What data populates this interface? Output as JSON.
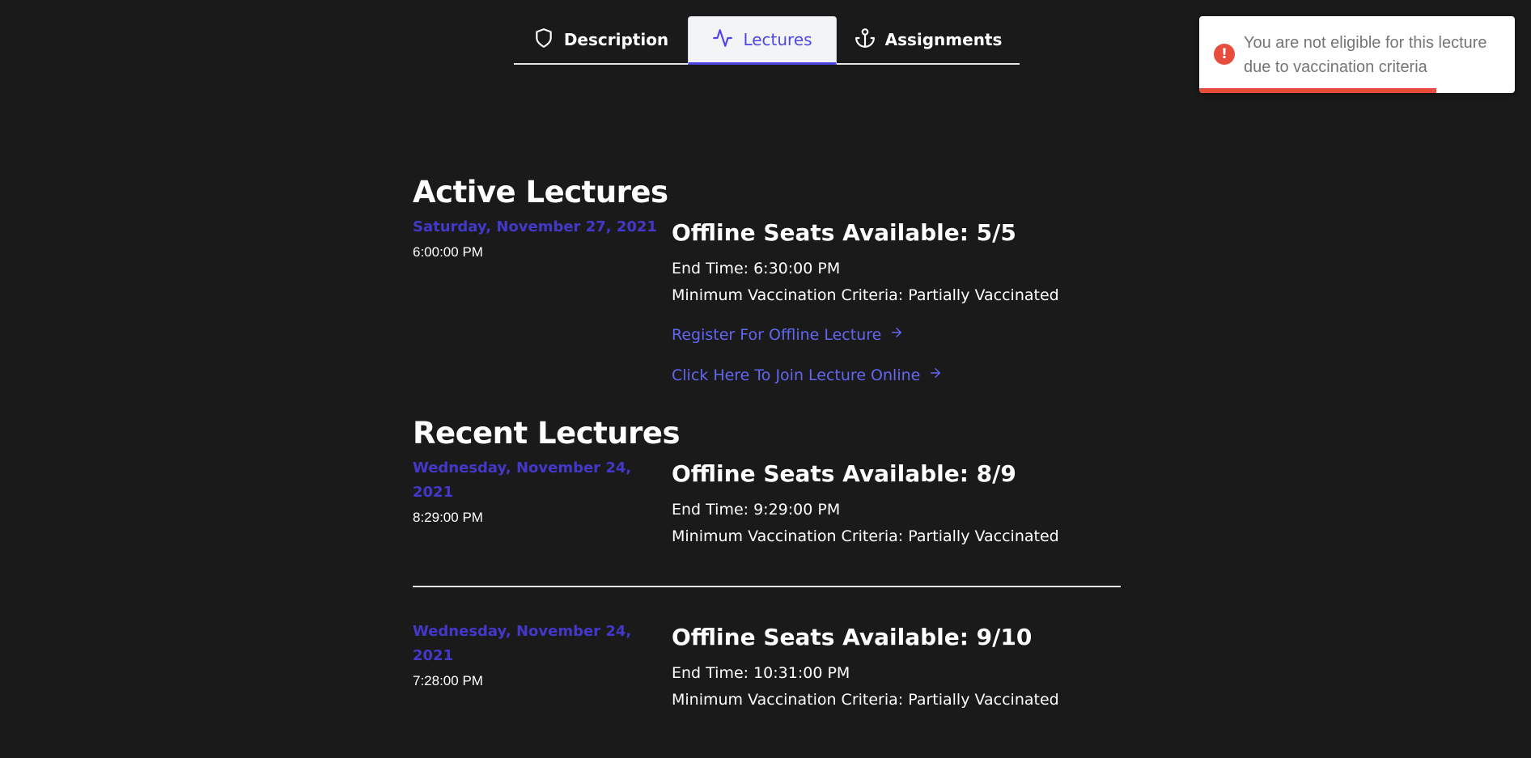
{
  "tabs": [
    {
      "label": "Description",
      "icon": "shield-icon"
    },
    {
      "label": "Lectures",
      "icon": "activity-icon",
      "active": true
    },
    {
      "label": "Assignments",
      "icon": "anchor-icon"
    }
  ],
  "toast": {
    "message": "You are not eligible for this lecture due to vaccination criteria",
    "progress": 0.75,
    "color": "#e74c3c"
  },
  "active": {
    "title": "Active Lectures",
    "lectures": [
      {
        "date": "Saturday, November 27, 2021",
        "time": "6:00:00 PM",
        "seats": "Offline Seats Available: 5/5",
        "end_time": "End Time: 6:30:00 PM",
        "criteria": "Minimum Vaccination Criteria: Partially Vaccinated",
        "register_label": "Register For Offline Lecture",
        "join_label": "Click Here To Join Lecture Online"
      }
    ]
  },
  "recent": {
    "title": "Recent Lectures",
    "lectures": [
      {
        "date": "Wednesday, November 24, 2021",
        "time": "8:29:00 PM",
        "seats": "Offline Seats Available: 8/9",
        "end_time": "End Time: 9:29:00 PM",
        "criteria": "Minimum Vaccination Criteria: Partially Vaccinated"
      },
      {
        "date": "Wednesday, November 24, 2021",
        "time": "7:28:00 PM",
        "seats": "Offline Seats Available: 9/10",
        "end_time": "End Time: 10:31:00 PM",
        "criteria": "Minimum Vaccination Criteria: Partially Vaccinated"
      }
    ]
  },
  "colors": {
    "accent": "#4f46e5",
    "link": "#6366f1",
    "date": "#4338ca",
    "background": "#1a1a1a"
  }
}
